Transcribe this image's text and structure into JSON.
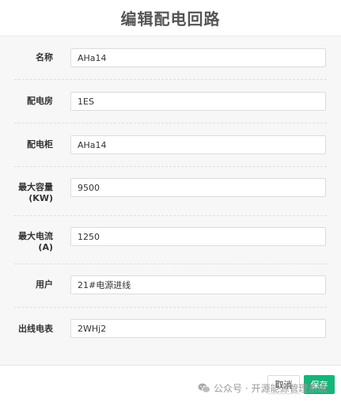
{
  "dialog": {
    "title": "编辑配电回路"
  },
  "form": {
    "fields": [
      {
        "label": "名称",
        "value": "AHa14"
      },
      {
        "label": "配电房",
        "value": "1ES"
      },
      {
        "label": "配电柜",
        "value": "AHa14"
      },
      {
        "label_line1": "最大容量",
        "label_line2": "(KW)",
        "value": "9500"
      },
      {
        "label_line1": "最大电流",
        "label_line2": "(A)",
        "value": "1250"
      },
      {
        "label": "用户",
        "value": "21#电源进线"
      },
      {
        "label": "出线电表",
        "value": "2WHj2"
      }
    ]
  },
  "footer": {
    "cancel_label": "取消",
    "save_label": "保存"
  },
  "watermark": {
    "text": "公众号 · 开源能源管理系统"
  },
  "colors": {
    "primary": "#15b57b",
    "form_background": "#f7f7f7"
  }
}
